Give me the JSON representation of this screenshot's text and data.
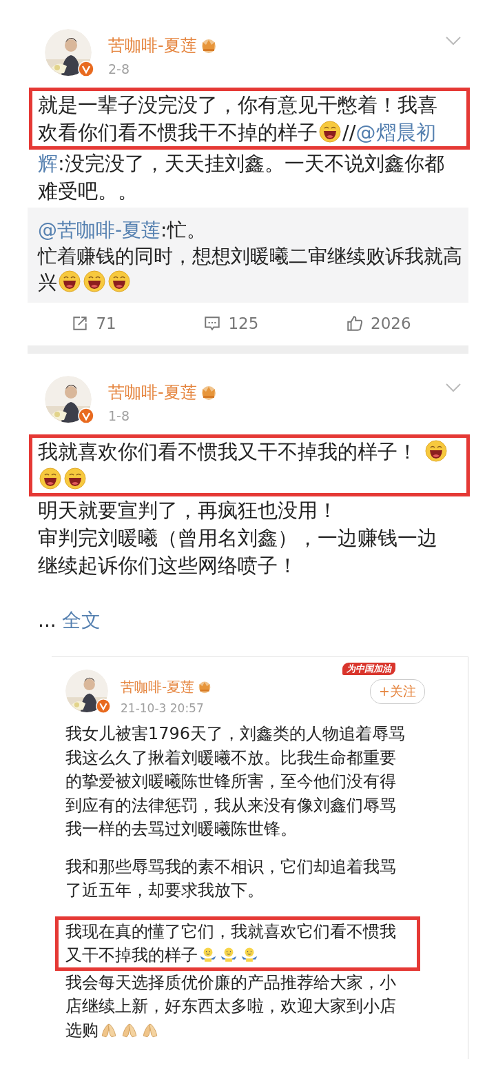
{
  "posts": [
    {
      "kind": "feed",
      "author": {
        "name": "苦咖啡-夏莲",
        "vip": true,
        "verified": true
      },
      "date": "2-8",
      "blocks": [
        {
          "highlighted": true,
          "spaced": false,
          "parts": [
            {
              "kind": "text",
              "text": "就是一辈子没完没了，你有意见干憋着！我喜欢看你们看不惯我干不掉的样子"
            },
            {
              "kind": "laugh"
            },
            {
              "kind": "text",
              "text": "//"
            },
            {
              "kind": "mention",
              "text": "@熠晨初"
            }
          ]
        },
        {
          "highlighted": false,
          "spaced": false,
          "parts": [
            {
              "kind": "mention",
              "text": "辉"
            },
            {
              "kind": "text",
              "text": ":没完没了，天天挂刘鑫。一天不说刘鑫你都难受吧。。"
            }
          ]
        }
      ],
      "repost": {
        "blocks": [
          {
            "parts": [
              {
                "kind": "mention",
                "text": "@苦咖啡-夏莲"
              },
              {
                "kind": "text",
                "text": ":忙。"
              }
            ]
          },
          {
            "parts": [
              {
                "kind": "text",
                "text": "忙着赚钱的同时，想想刘暖曦二审继续败诉我就高兴"
              },
              {
                "kind": "laugh"
              },
              {
                "kind": "laugh"
              },
              {
                "kind": "laugh"
              }
            ]
          }
        ]
      },
      "actions": [
        {
          "kind": "share",
          "count": "71"
        },
        {
          "kind": "comment",
          "count": "125"
        },
        {
          "kind": "like",
          "count": "2026"
        }
      ]
    },
    {
      "kind": "feed",
      "author": {
        "name": "苦咖啡-夏莲",
        "vip": true,
        "verified": true
      },
      "date": "1-8",
      "blocks": [
        {
          "highlighted": true,
          "spaced": false,
          "parts": [
            {
              "kind": "text",
              "text": "我就喜欢你们看不惯我又干不掉我的样子！ "
            },
            {
              "kind": "laugh"
            },
            {
              "kind": "laugh"
            },
            {
              "kind": "laugh"
            }
          ]
        },
        {
          "highlighted": false,
          "spaced": false,
          "parts": [
            {
              "kind": "text",
              "text": "明天就要宣判了，再疯狂也没用！"
            }
          ]
        },
        {
          "highlighted": false,
          "spaced": false,
          "parts": [
            {
              "kind": "text",
              "text": "审判完刘暖曦（曾用名刘鑫），一边赚钱一边继续起诉你们这些网络喷子！"
            }
          ]
        }
      ],
      "more": {
        "ellipsis": "...",
        "link": "全文"
      }
    },
    {
      "kind": "quoted",
      "author": {
        "name": "苦咖啡-夏莲",
        "vip": true,
        "verified": true
      },
      "date": "21-10-3 20:57",
      "follow": {
        "label": "+关注",
        "badge": "为中国加油"
      },
      "blocks": [
        {
          "highlighted": false,
          "spaced": false,
          "parts": [
            {
              "kind": "text",
              "text": "我女儿被害1796天了，刘鑫类的人物追着辱骂我这么久了揪着刘暖曦不放。比我生命都重要的挚爱被刘暖曦陈世锋所害，至今他们没有得到应有的法律惩罚，我从来没有像刘鑫们辱骂我一样的去骂过刘暖曦陈世锋。"
            }
          ]
        },
        {
          "highlighted": false,
          "spaced": true,
          "parts": [
            {
              "kind": "text",
              "text": "我和那些辱骂我的素不相识，它们却追着我骂了近五年，却要求我放下。"
            }
          ]
        },
        {
          "highlighted": true,
          "spaced": true,
          "parts": [
            {
              "kind": "text",
              "text": "我现在真的懂了它们，我就喜欢它们看不惯我又干不掉我的样子"
            },
            {
              "kind": "shrug"
            },
            {
              "kind": "shrug"
            },
            {
              "kind": "shrug"
            }
          ]
        },
        {
          "highlighted": false,
          "spaced": false,
          "parts": [
            {
              "kind": "text",
              "text": "我会每天选择质优价廉的产品推荐给大家，小店继续上新，好东西太多啦，欢迎大家到小店选购"
            },
            {
              "kind": "hands"
            },
            {
              "kind": "hands"
            },
            {
              "kind": "hands"
            }
          ]
        }
      ]
    }
  ]
}
